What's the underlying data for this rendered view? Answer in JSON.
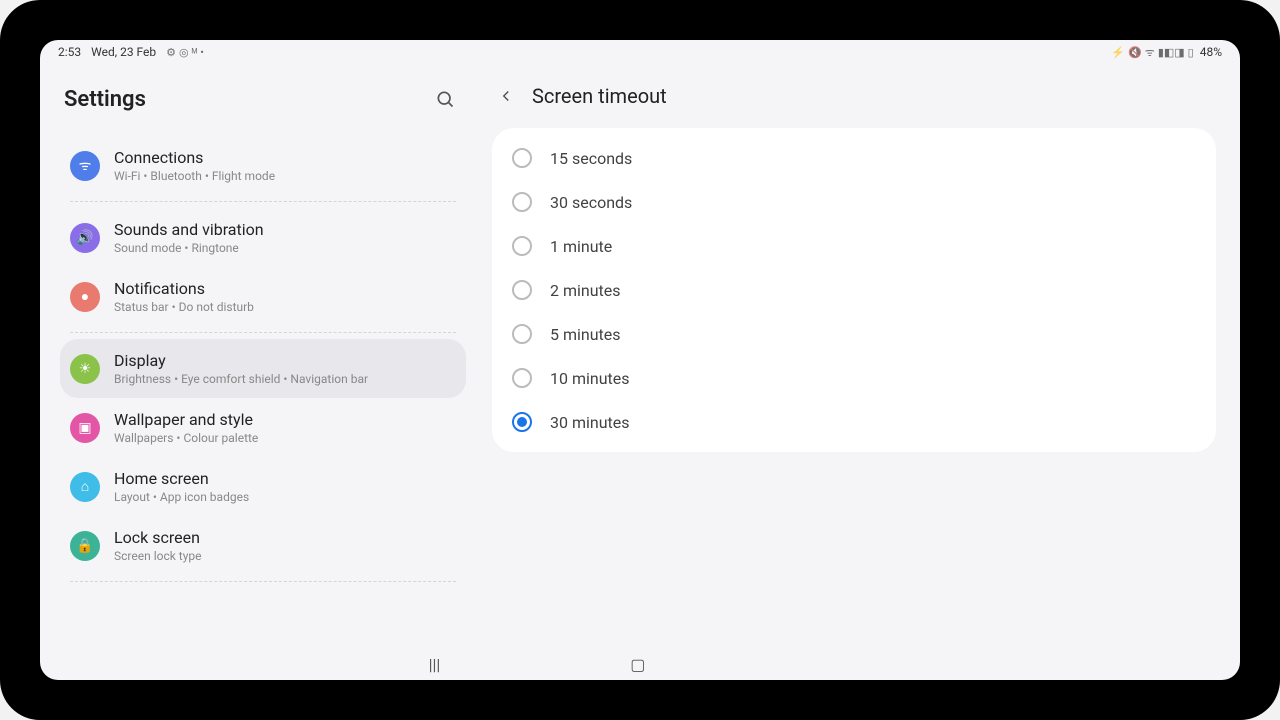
{
  "status": {
    "time": "2:53",
    "date": "Wed, 23 Feb",
    "battery": "48%",
    "icons_left": [
      "⚙",
      "◎",
      "ᴹ",
      "•"
    ],
    "icons_right": [
      "⚡",
      "🔇",
      "ᯤ",
      "▮◧◨",
      "▯"
    ]
  },
  "sidebar": {
    "title": "Settings",
    "items": [
      {
        "id": "connections",
        "icon": "wifi-icon",
        "icon_bg": "#4f7de9",
        "title": "Connections",
        "subtitle": "Wi-Fi • Bluetooth • Flight mode",
        "selected": false
      },
      {
        "id": "sounds-vibration",
        "icon": "sound-icon",
        "icon_bg": "#8a6ee8",
        "title": "Sounds and vibration",
        "subtitle": "Sound mode • Ringtone",
        "selected": false
      },
      {
        "id": "notifications",
        "icon": "notifications-icon",
        "icon_bg": "#e97a6f",
        "title": "Notifications",
        "subtitle": "Status bar • Do not disturb",
        "selected": false
      },
      {
        "id": "display",
        "icon": "display-icon",
        "icon_bg": "#8bc34a",
        "title": "Display",
        "subtitle": "Brightness • Eye comfort shield • Navigation bar",
        "selected": true
      },
      {
        "id": "wallpaper-style",
        "icon": "wallpaper-icon",
        "icon_bg": "#e356a6",
        "title": "Wallpaper and style",
        "subtitle": "Wallpapers • Colour palette",
        "selected": false
      },
      {
        "id": "home-screen",
        "icon": "home-icon",
        "icon_bg": "#3fbce8",
        "title": "Home screen",
        "subtitle": "Layout • App icon badges",
        "selected": false
      },
      {
        "id": "lock-screen",
        "icon": "lock-icon",
        "icon_bg": "#3cb296",
        "title": "Lock screen",
        "subtitle": "Screen lock type",
        "selected": false
      }
    ],
    "dividers_after": [
      "connections",
      "notifications",
      "lock-screen"
    ]
  },
  "detail": {
    "title": "Screen timeout",
    "options": [
      {
        "id": "15s",
        "label": "15 seconds",
        "selected": false
      },
      {
        "id": "30s",
        "label": "30 seconds",
        "selected": false
      },
      {
        "id": "1m",
        "label": "1 minute",
        "selected": false
      },
      {
        "id": "2m",
        "label": "2 minutes",
        "selected": false
      },
      {
        "id": "5m",
        "label": "5 minutes",
        "selected": false
      },
      {
        "id": "10m",
        "label": "10 minutes",
        "selected": false
      },
      {
        "id": "30m",
        "label": "30 minutes",
        "selected": true
      }
    ]
  },
  "icon_glyphs": {
    "wifi-icon": "ᯤ",
    "sound-icon": "🔊",
    "notifications-icon": "●",
    "display-icon": "☀",
    "wallpaper-icon": "▣",
    "home-icon": "⌂",
    "lock-icon": "🔒"
  }
}
